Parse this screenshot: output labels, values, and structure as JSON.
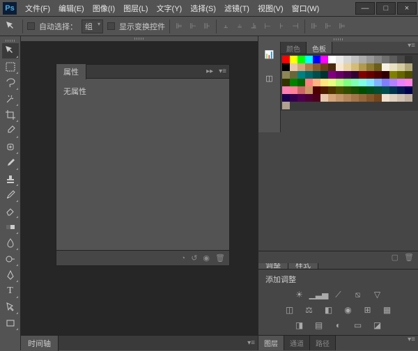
{
  "app": {
    "logo": "Ps"
  },
  "menu": [
    "文件(F)",
    "编辑(E)",
    "图像(I)",
    "图层(L)",
    "文字(Y)",
    "选择(S)",
    "滤镜(T)",
    "视图(V)",
    "窗口(W)"
  ],
  "window_buttons": {
    "min": "—",
    "max": "□",
    "close": "×"
  },
  "options": {
    "auto_select_label": "自动选择：",
    "group_label": "组",
    "show_transform_label": "显示变换控件"
  },
  "properties_panel": {
    "tab": "属性",
    "content": "无属性"
  },
  "timeline": {
    "tab": "时间轴"
  },
  "swatches": {
    "tab_color": "颜色",
    "tab_swatches": "色板",
    "colors": [
      "#ff0000",
      "#ffff00",
      "#00ff00",
      "#00ffff",
      "#0000ff",
      "#ff00ff",
      "#ffffff",
      "#ebebeb",
      "#d6d6d6",
      "#c2c2c2",
      "#adadad",
      "#999999",
      "#858585",
      "#707070",
      "#5c5c5c",
      "#474747",
      "#333333",
      "#000000",
      "#e8c9af",
      "#d4a57a",
      "#b07d4a",
      "#8c5a2a",
      "#6b3f17",
      "#4a2a0c",
      "#f7e7ce",
      "#e8d4a2",
      "#d4bc76",
      "#b09a4e",
      "#8c7a2e",
      "#6b5e18",
      "#f5f0e1",
      "#e8e0c2",
      "#d4cca0",
      "#b0a87a",
      "#8c8556",
      "#6b6638",
      "#008080",
      "#006666",
      "#004d4d",
      "#003333",
      "#800080",
      "#660066",
      "#4d004d",
      "#330033",
      "#800000",
      "#660000",
      "#4d0000",
      "#330000",
      "#808000",
      "#666600",
      "#4d4d00",
      "#333300",
      "#008000",
      "#006600",
      "#ff8080",
      "#ffb380",
      "#ffe680",
      "#e6ff80",
      "#b3ff80",
      "#80ff80",
      "#80ffb3",
      "#80ffe6",
      "#80e6ff",
      "#80b3ff",
      "#8080ff",
      "#b380ff",
      "#e680ff",
      "#ff80e6",
      "#ff80b3",
      "#ff8099",
      "#cc6666",
      "#cc9966",
      "#4d0000",
      "#4d1a00",
      "#4d3300",
      "#4d4d00",
      "#334d00",
      "#1a4d00",
      "#004d00",
      "#004d1a",
      "#004d33",
      "#004d4d",
      "#00334d",
      "#001a4d",
      "#00004d",
      "#1a004d",
      "#33004d",
      "#4d004d",
      "#4d0033",
      "#4d001a",
      "#e8c9af",
      "#d4a57a",
      "#c4956a",
      "#b5855a",
      "#a5754a",
      "#95653a",
      "#85552a",
      "#75451a",
      "#f0e0d0",
      "#e0d0c0",
      "#d0c0b0",
      "#c0b0a0",
      "#b0a090"
    ]
  },
  "adjustments": {
    "tab_adjust": "调整",
    "tab_style": "样式",
    "label": "添加调整"
  },
  "bottom_tabs": {
    "layers": "图层",
    "channels": "通道",
    "paths": "路径"
  }
}
